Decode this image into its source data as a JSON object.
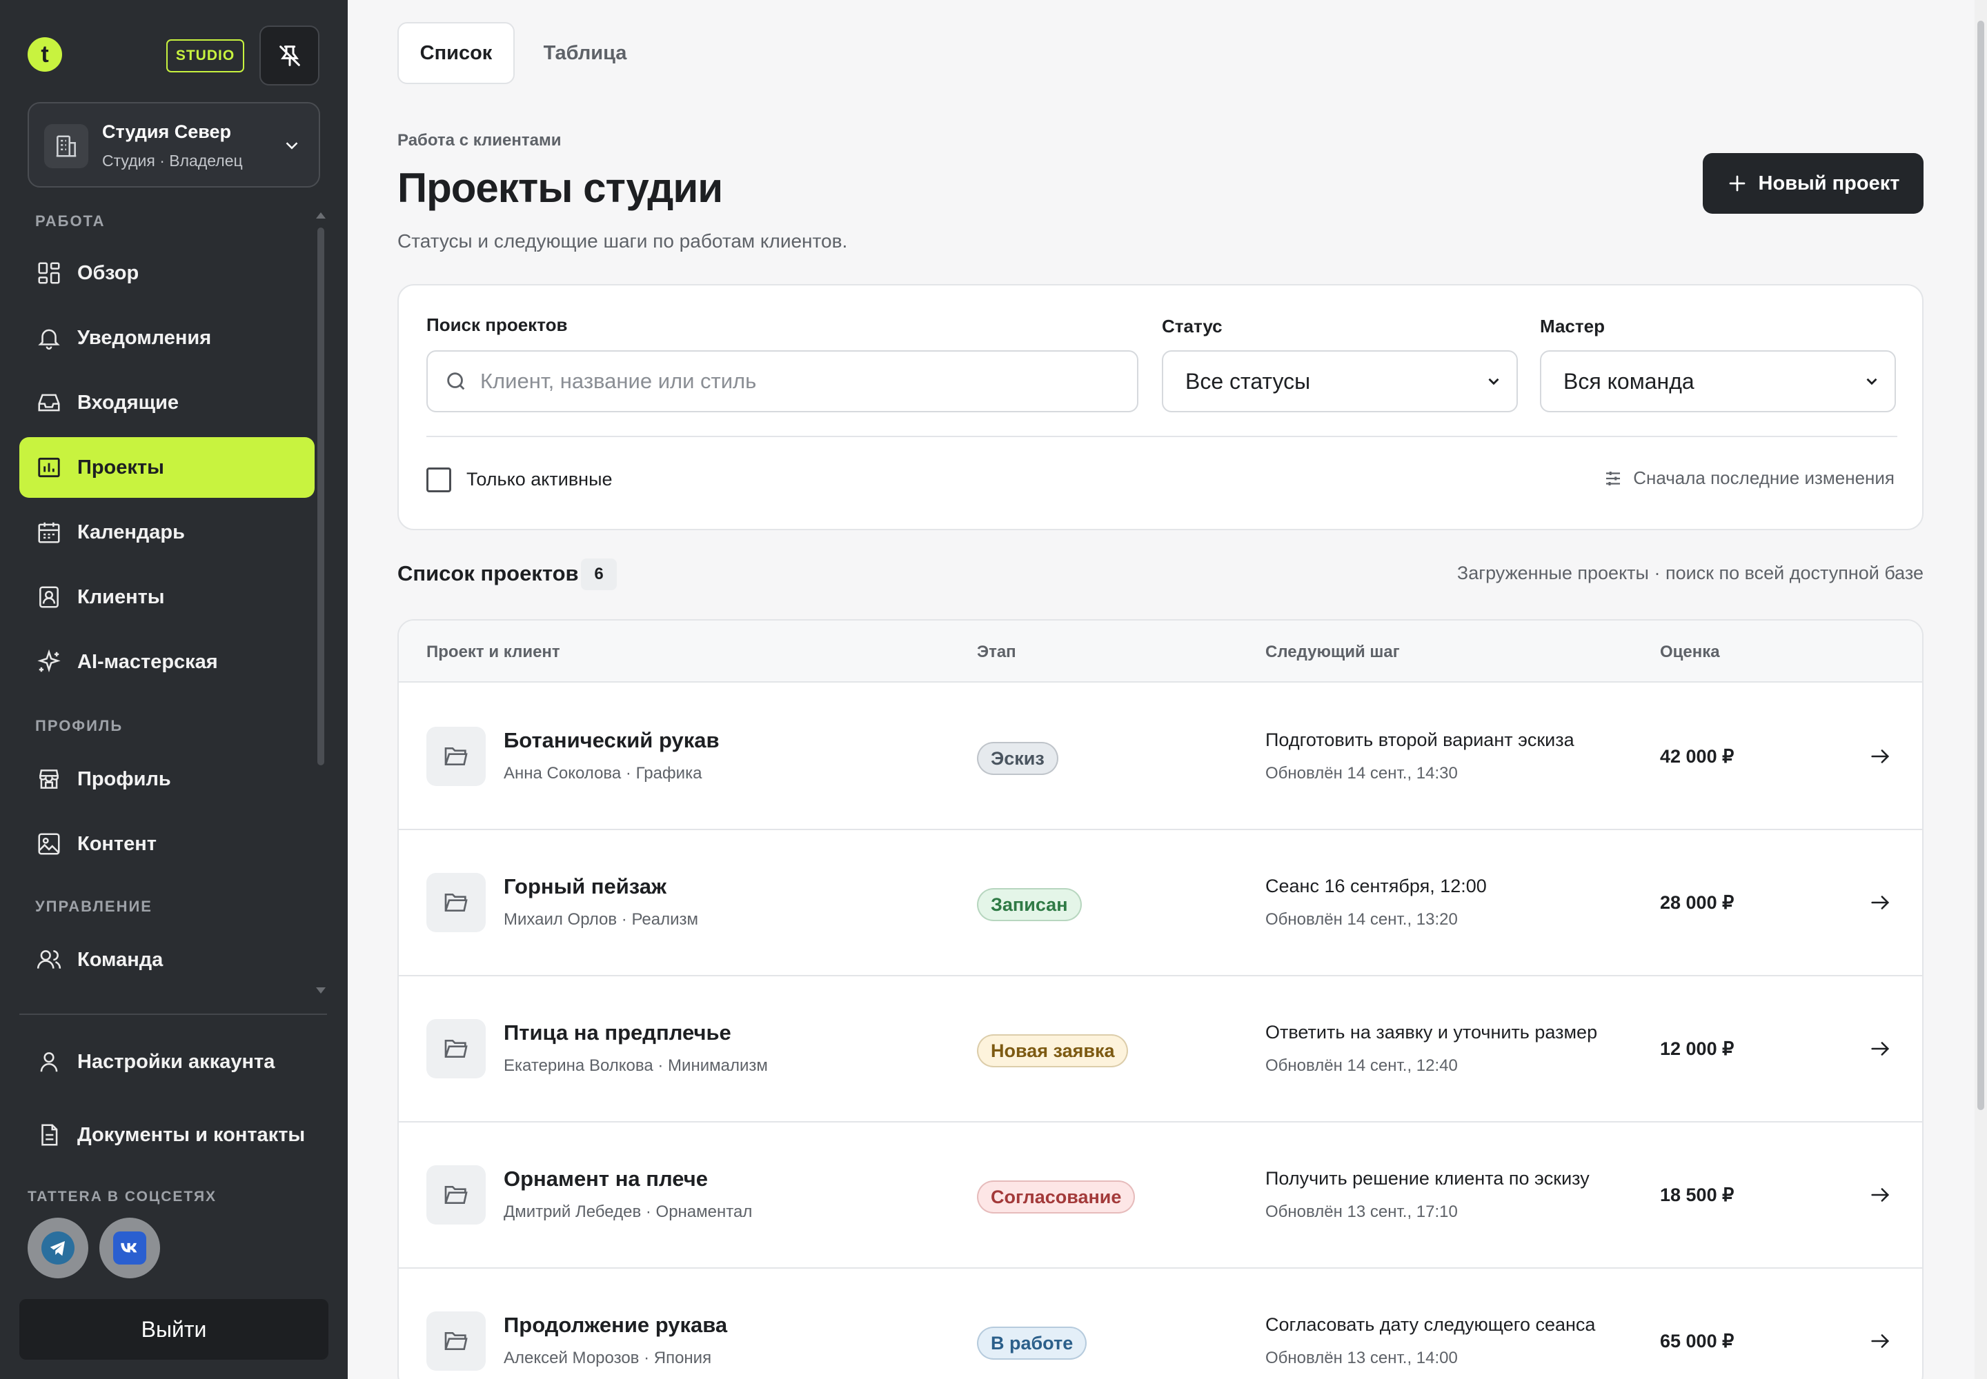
{
  "brand": {
    "logo_letter": "t",
    "badge": "STUDIO"
  },
  "workspace": {
    "title": "Студия Север",
    "subtitle": "Студия · Владелец"
  },
  "sidebar": {
    "sections": {
      "work": "РАБОТА",
      "profile": "ПРОФИЛЬ",
      "manage": "УПРАВЛЕНИЕ"
    },
    "items": [
      {
        "label": "Обзор",
        "icon": "dashboard-icon"
      },
      {
        "label": "Уведомления",
        "icon": "bell-icon"
      },
      {
        "label": "Входящие",
        "icon": "inbox-icon"
      },
      {
        "label": "Проекты",
        "icon": "projects-icon",
        "active": true
      },
      {
        "label": "Календарь",
        "icon": "calendar-icon"
      },
      {
        "label": "Клиенты",
        "icon": "clients-icon"
      },
      {
        "label": "AI-мастерская",
        "icon": "sparkle-icon"
      },
      {
        "label": "Профиль",
        "icon": "store-icon"
      },
      {
        "label": "Контент",
        "icon": "image-icon"
      },
      {
        "label": "Команда",
        "icon": "team-icon"
      }
    ],
    "bottom": {
      "account": "Настройки аккаунта",
      "docs": "Документы и контакты"
    },
    "social_label": "TATTERA В СОЦСЕТЯХ",
    "logout": "Выйти"
  },
  "tabs": {
    "list": "Список",
    "table": "Таблица"
  },
  "header": {
    "breadcrumb": "Работа с клиентами",
    "title": "Проекты студии",
    "subtitle": "Статусы и следующие шаги по работам клиентов.",
    "new_button": "Новый проект"
  },
  "filters": {
    "search_label": "Поиск проектов",
    "search_placeholder": "Клиент, название или стиль",
    "status_label": "Статус",
    "status_value": "Все статусы",
    "master_label": "Мастер",
    "master_value": "Вся команда",
    "only_active": "Только активные",
    "sort": "Сначала последние изменения"
  },
  "list": {
    "title": "Список проектов",
    "count": "6",
    "note": "Загруженные проекты · поиск по всей доступной базе",
    "columns": {
      "project": "Проект и клиент",
      "stage": "Этап",
      "next": "Следующий шаг",
      "price": "Оценка"
    },
    "rows": [
      {
        "name": "Ботанический рукав",
        "client": "Анна Соколова · Графика",
        "stage": "Эскиз",
        "stage_color": "#e6eaee",
        "stage_text": "#4a5560",
        "step": "Подготовить второй вариант эскиза",
        "updated": "Обновлён 14 сент., 14:30",
        "price": "42 000 ₽"
      },
      {
        "name": "Горный пейзаж",
        "client": "Михаил Орлов · Реализм",
        "stage": "Записан",
        "stage_color": "#e4f5e8",
        "stage_text": "#2f7a45",
        "step": "Сеанс 16 сентября, 12:00",
        "updated": "Обновлён 14 сент., 13:20",
        "price": "28 000 ₽"
      },
      {
        "name": "Птица на предплечье",
        "client": "Екатерина Волкова · Минимализм",
        "stage": "Новая заявка",
        "stage_color": "#fdf3dc",
        "stage_text": "#7d5a12",
        "step": "Ответить на заявку и уточнить размер",
        "updated": "Обновлён 14 сент., 12:40",
        "price": "12 000 ₽"
      },
      {
        "name": "Орнамент на плече",
        "client": "Дмитрий Лебедев · Орнаментал",
        "stage": "Согласование",
        "stage_color": "#fde6e6",
        "stage_text": "#a33a3a",
        "step": "Получить решение клиента по эскизу",
        "updated": "Обновлён 13 сент., 17:10",
        "price": "18 500 ₽"
      },
      {
        "name": "Продолжение рукава",
        "client": "Алексей Морозов · Япония",
        "stage": "В работе",
        "stage_color": "#e4eff8",
        "stage_text": "#2b5f8a",
        "step": "Согласовать дату следующего сеанса",
        "updated": "Обновлён 13 сент., 14:00",
        "price": "65 000 ₽"
      }
    ]
  },
  "colors": {
    "accent": "#c8f33f",
    "sidebar": "#2a2d31",
    "dark_button": "#23262a"
  }
}
